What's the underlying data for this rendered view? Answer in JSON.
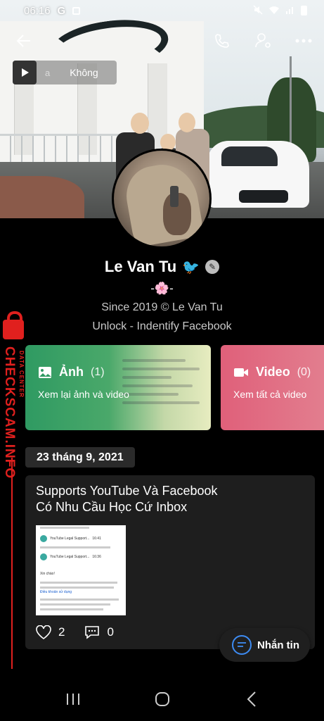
{
  "status_bar": {
    "time": "06:16",
    "g_label": "G"
  },
  "music": {
    "letter": "a",
    "title": "Không"
  },
  "profile": {
    "name": "Le Van Tu",
    "name_emoji": "🐦",
    "flower": "-🌸-",
    "bio_line1": "Since 2019 © Le Van Tu",
    "bio_line2": "Unlock - Indentify Facebook"
  },
  "watermark": {
    "main": "CHECKSCAM.INFO",
    "sub": "DATA CENTER"
  },
  "photo_card": {
    "title": "Ảnh",
    "count": "(1)",
    "subtitle": "Xem lại ảnh và video"
  },
  "video_card": {
    "title": "Video",
    "count": "(0)",
    "subtitle": "Xem tất cả video"
  },
  "date_label": "23 tháng 9, 2021",
  "post": {
    "text_line1": "Supports YouTube Và Facebook",
    "text_line2": "Có Nhu Cầu Học Cứ Inbox",
    "image": {
      "row1": "YouTube Legal Support...",
      "row1_time": "16:41",
      "row2": "YouTube Legal Support...",
      "row2_time": "16:36",
      "greeting": "Xin chào!",
      "body_link": "Điều khoản sử dụng"
    },
    "likes": "2",
    "comments": "0"
  },
  "fab": {
    "label": "Nhắn tin"
  },
  "colors": {
    "accent_blue": "#3d8bf2",
    "watermark_red": "#e0201e",
    "photo_card_green": "#2f9a62",
    "video_card_pink": "#e0607a"
  }
}
